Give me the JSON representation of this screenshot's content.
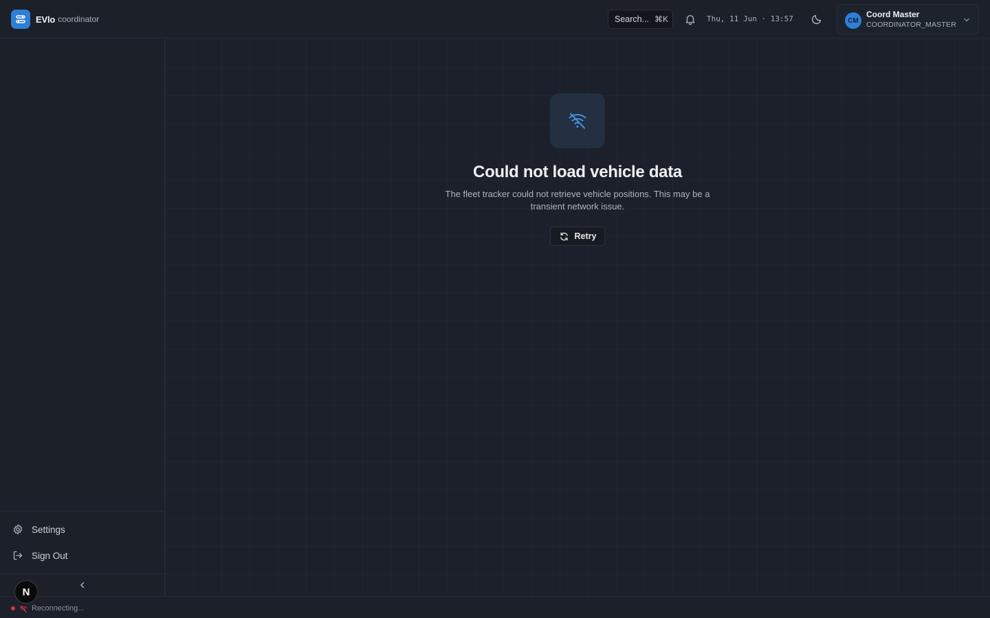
{
  "header": {
    "brand_name": "EVlo",
    "brand_sub": "coordinator",
    "search_label": "Search...",
    "search_shortcut": "⌘K",
    "datetime": "Thu, 11 Jun · 13:57",
    "user": {
      "initials": "CM",
      "name": "Coord Master",
      "role": "COORDINATOR_MASTER"
    }
  },
  "sidebar": {
    "bottom_items": [
      {
        "label": "Settings",
        "icon": "gear-icon"
      },
      {
        "label": "Sign Out",
        "icon": "sign-out-icon"
      }
    ]
  },
  "main": {
    "error_icon": "wifi-off-icon",
    "error_title": "Could not load vehicle data",
    "error_description": "The fleet tracker could not retrieve vehicle positions. This may be a transient network issue.",
    "retry_label": "Retry"
  },
  "status": {
    "text": "Reconnecting...",
    "dot_color": "#d83a3a"
  },
  "badge": {
    "letter": "N"
  },
  "colors": {
    "accent": "#2e7fd6",
    "background": "#1a1f27"
  }
}
